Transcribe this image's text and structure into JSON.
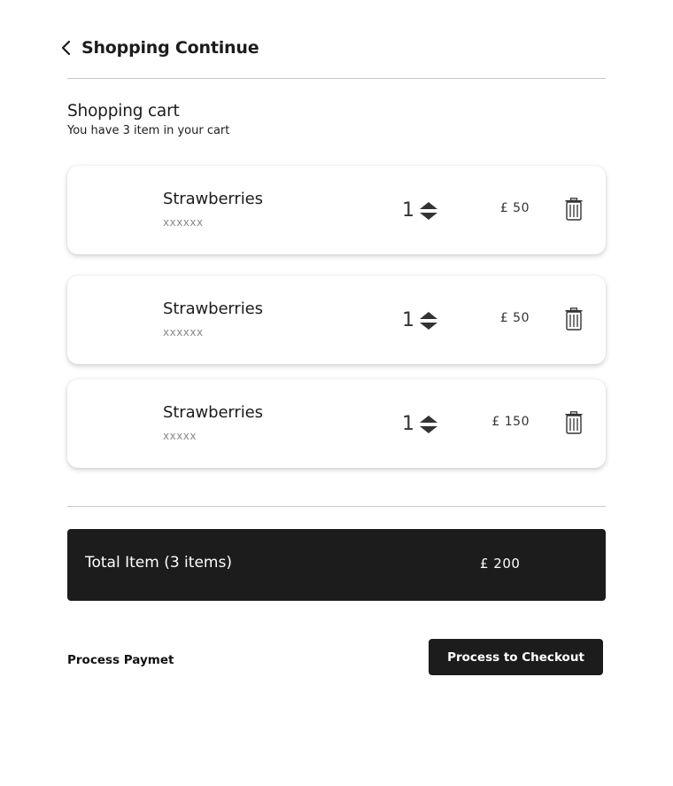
{
  "header": {
    "back_label": "Shopping Continue",
    "back_icon": "chevron-left-icon"
  },
  "cart": {
    "title": "Shopping cart",
    "subtitle": "You have 3 item in your cart"
  },
  "items": [
    {
      "name": "Strawberries",
      "desc": "xxxxxx",
      "qty": "1",
      "price": "£ 50"
    },
    {
      "name": "Strawberries",
      "desc": "xxxxxx",
      "qty": "1",
      "price": "£ 50"
    },
    {
      "name": "Strawberries",
      "desc": "xxxxx",
      "qty": "1",
      "price": "£ 150"
    }
  ],
  "total": {
    "label": "Total Item (3 items)",
    "amount": "£ 200"
  },
  "footer": {
    "process_label": "Process Paymet",
    "checkout_label": "Process to Checkout"
  },
  "colors": {
    "dark": "#1c1c1c",
    "muted_text": "#8a8a8a",
    "divider": "#c8c8c8",
    "background": "#ffffff"
  },
  "icons": {
    "stepper": "stepper-arrows-icon",
    "delete": "trash-icon"
  }
}
